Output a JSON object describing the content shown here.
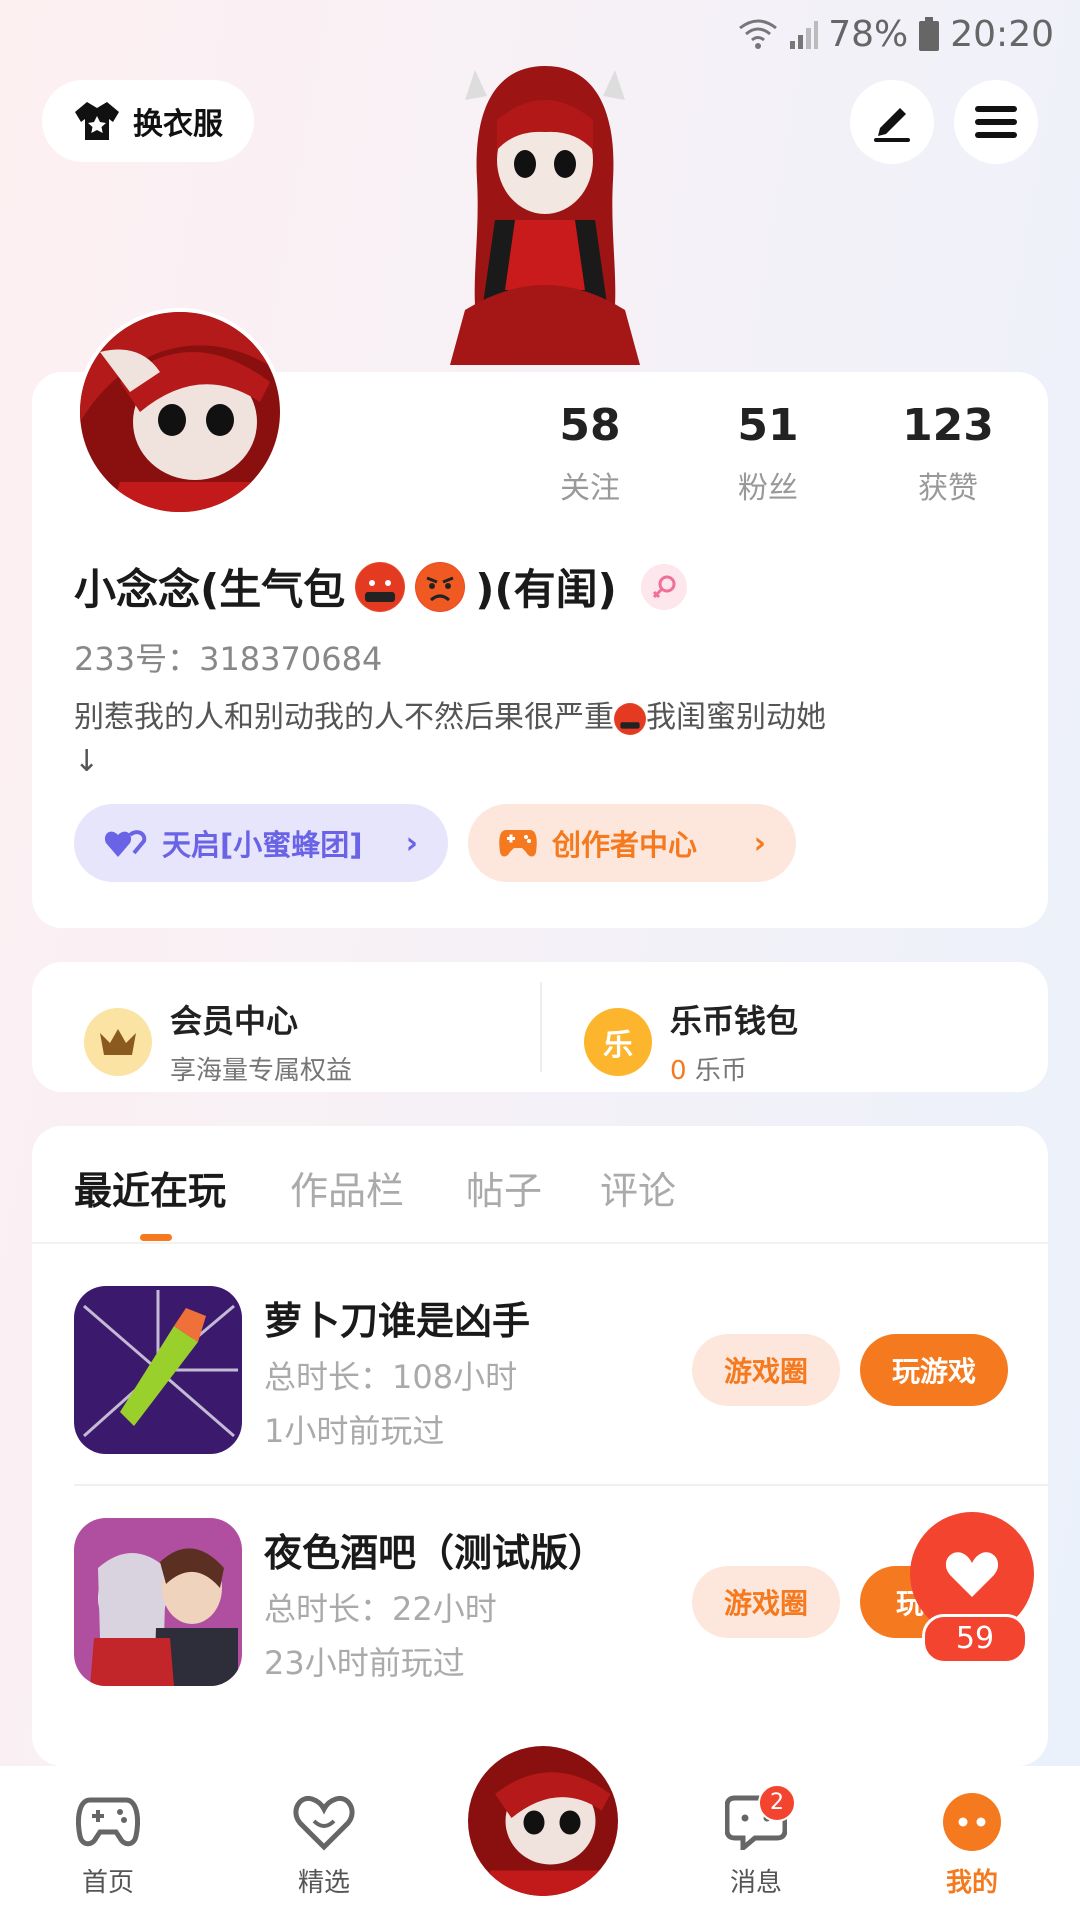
{
  "status_bar": {
    "battery": "78%",
    "time": "20:20"
  },
  "top": {
    "outfit_label": "换衣服"
  },
  "profile": {
    "stats": [
      {
        "value": "58",
        "label": "关注"
      },
      {
        "value": "51",
        "label": "粉丝"
      },
      {
        "value": "123",
        "label": "获赞"
      }
    ],
    "nickname_part1": "小念念(生气包",
    "nickname_part2": ")(有闺)",
    "uid": "233号：318370684",
    "bio": "别惹我的人和别动我的人不然后果很严重",
    "bio_tail": "我闺蜜别动她",
    "bio_arrow": "↓",
    "team_label": "天启[小蜜蜂团]",
    "creator_label": "创作者中心"
  },
  "member": {
    "vip_title": "会员中心",
    "vip_sub": "享海量专属权益",
    "wallet_title": "乐币钱包",
    "wallet_amount": "0",
    "wallet_unit": "乐币",
    "coin_char": "乐"
  },
  "tabs": [
    "最近在玩",
    "作品栏",
    "帖子",
    "评论"
  ],
  "games": [
    {
      "name": "萝卜刀谁是凶手",
      "total": "总时长：108小时",
      "last": "1小时前玩过",
      "circle": "游戏圈",
      "play": "玩游戏"
    },
    {
      "name": "夜色酒吧（测试版）",
      "total": "总时长：22小时",
      "last": "23小时前玩过",
      "circle": "游戏圈",
      "play": "玩"
    }
  ],
  "like_count": "59",
  "bottom_nav": [
    {
      "label": "首页",
      "icon": "gamepad-icon"
    },
    {
      "label": "精选",
      "icon": "heart-icon"
    },
    {
      "label": "消息",
      "icon": "chat-icon",
      "badge": "2"
    },
    {
      "label": "我的",
      "icon": "profile-icon"
    }
  ],
  "colors": {
    "accent": "#f57a1f",
    "like": "#f2442e",
    "team": "#6a63e6"
  }
}
